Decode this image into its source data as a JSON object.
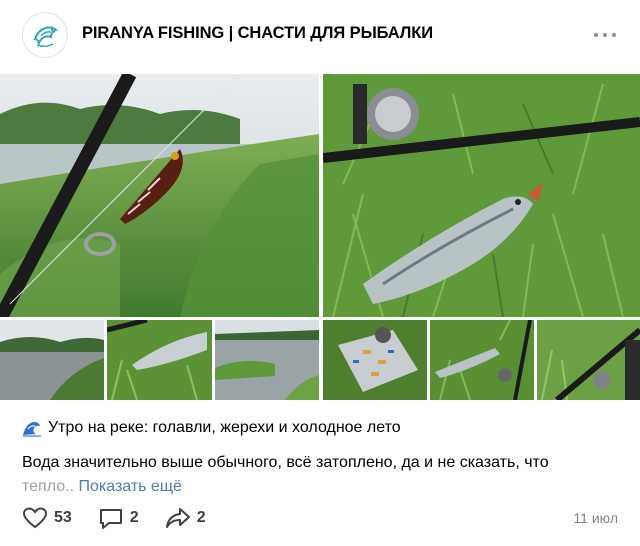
{
  "community": {
    "name": "PIRANYA FISHING | СНАСТИ ДЛЯ РЫБАЛКИ",
    "avatar_icon": "fish-logo-icon",
    "more_icon": "more-dots-icon"
  },
  "post": {
    "headline": "Утро на реке: голавли, жерехи и холодное лето",
    "headline_icon": "wave-icon",
    "text_main": "Вода значительно выше обычного, всё затоплено, да и не сказать, что",
    "text_fade": "тепло..",
    "show_more": "Показать ещё"
  },
  "footer": {
    "likes": "53",
    "comments": "2",
    "shares": "2",
    "date": "11 июл"
  },
  "colors": {
    "link": "#4a7bb0",
    "icon": "#3b4046",
    "muted": "#7e858d",
    "logo": "#2fa7b8"
  }
}
